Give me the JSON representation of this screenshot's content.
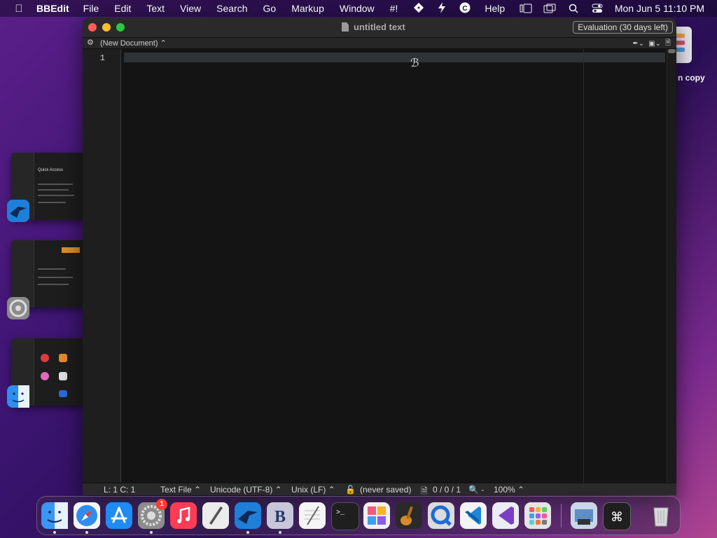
{
  "menubar": {
    "app_name": "BBEdit",
    "menus": [
      "File",
      "Edit",
      "Text",
      "View",
      "Search",
      "Go",
      "Markup",
      "Window",
      "#!",
      "Help"
    ],
    "clock": "Mon Jun 5  11:10 PM"
  },
  "window": {
    "title": "untitled text",
    "evaluation": "Evaluation (30 days left)",
    "doc_selector": "(New Document) ⌃",
    "line_number": "1"
  },
  "status": {
    "position": "L: 1  C: 1",
    "file_type": "Text File ⌃",
    "encoding": "Unicode (UTF-8) ⌃",
    "line_endings": "Unix (LF) ⌃",
    "saved": "(never saved)",
    "counts": "0 / 0 / 1",
    "zoom": "100% ⌃"
  },
  "desktop": {
    "item_label": "n copy"
  },
  "stage": {
    "quick_access": "Quick Access"
  },
  "dock": {
    "badge_count": "1",
    "icons": [
      "finder",
      "safari",
      "app-store",
      "system-settings",
      "music",
      "script-editor",
      "migration",
      "bbedit",
      "textedit",
      "terminal",
      "pixelmator",
      "garageband",
      "quicktime",
      "vscode",
      "visual-studio",
      "launchpad",
      "preview",
      "keystroke",
      "trash"
    ]
  },
  "colors": {
    "accent_close": "#ff5f57",
    "accent_minimize": "#febc2e",
    "accent_zoom": "#28c840",
    "editor_bg": "#141414"
  }
}
